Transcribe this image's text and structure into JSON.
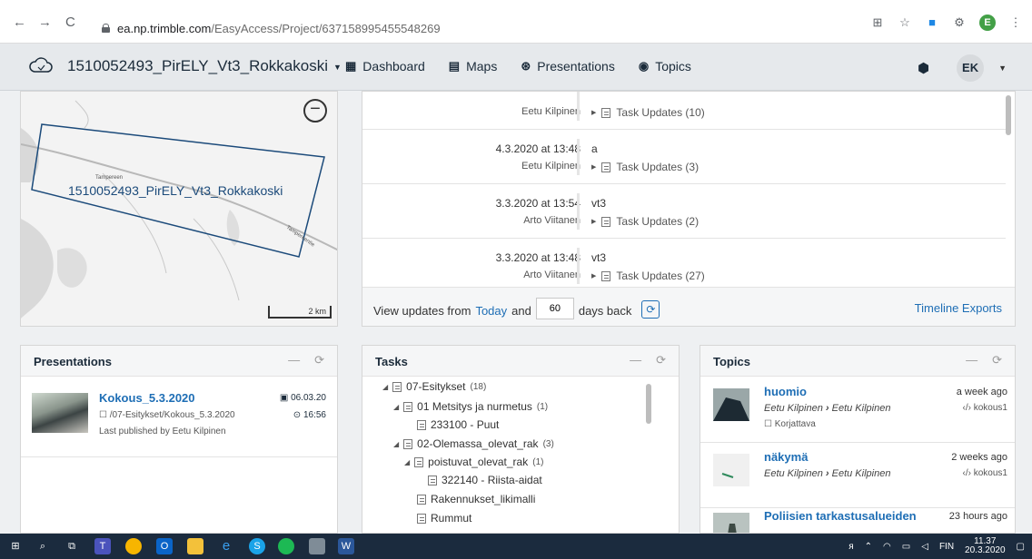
{
  "browser": {
    "back": "←",
    "forward": "→",
    "reload": "C",
    "url_host": "ea.np.trimble.com",
    "url_path": "/EasyAccess/Project/637158995455548269",
    "profile_initial": "E"
  },
  "header": {
    "project_title": "1510052493_PirELY_Vt3_Rokkakoski",
    "nav": [
      {
        "label": "Dashboard",
        "icon": "▦"
      },
      {
        "label": "Maps",
        "icon": "▤"
      },
      {
        "label": "Presentations",
        "icon": "⊛"
      },
      {
        "label": "Topics",
        "icon": "◉"
      }
    ],
    "user_initials": "EK"
  },
  "map": {
    "label": "1510052493_PirELY_Vt3_Rokkakoski",
    "zoom_out": "−",
    "scale": "2 km",
    "road_label_1": "Tampereen",
    "road_label_2": "Tampereentie"
  },
  "updates": {
    "rows": [
      {
        "date": "",
        "author": "Eetu Kilpinen",
        "title": "",
        "tasks": "Task Updates (10)"
      },
      {
        "date": "4.3.2020 at 13:48",
        "author": "Eetu Kilpinen",
        "title": "a",
        "tasks": "Task Updates (3)"
      },
      {
        "date": "3.3.2020 at 13:54",
        "author": "Arto Viitanen",
        "title": "vt3",
        "tasks": "Task Updates (2)"
      },
      {
        "date": "3.3.2020 at 13:48",
        "author": "Arto Viitanen",
        "title": "vt3",
        "tasks": "Task Updates (27)"
      }
    ],
    "footer_prefix": "View updates from",
    "footer_today": "Today",
    "footer_and": "and",
    "days_value": "60",
    "footer_suffix": "days back",
    "timeline_exports": "Timeline Exports"
  },
  "presentations": {
    "title": "Presentations",
    "item": {
      "name": "Kokous_5.3.2020",
      "path": "/07-Esitykset/Kokous_5.3.2020",
      "published": "Last published by Eetu Kilpinen",
      "date": "06.03.20",
      "time": "16:56"
    }
  },
  "tasks": {
    "title": "Tasks",
    "tree": [
      {
        "label": "07-Esitykset",
        "count": "(18)"
      },
      {
        "label": "01 Metsitys ja nurmetus",
        "count": "(1)"
      },
      {
        "label": "233100 - Puut",
        "count": ""
      },
      {
        "label": "02-Olemassa_olevat_rak",
        "count": "(3)"
      },
      {
        "label": "poistuvat_olevat_rak",
        "count": "(1)"
      },
      {
        "label": "322140 - Riista-aidat",
        "count": ""
      },
      {
        "label": "Rakennukset_likimalli",
        "count": ""
      },
      {
        "label": "Rummut",
        "count": ""
      }
    ]
  },
  "topics": {
    "title": "Topics",
    "items": [
      {
        "title": "huomio",
        "from": "Eetu Kilpinen",
        "to": "Eetu Kilpinen",
        "tag": "Korjattava",
        "time": "a week ago",
        "code": "kokous1"
      },
      {
        "title": "näkymä",
        "from": "Eetu Kilpinen",
        "to": "Eetu Kilpinen",
        "tag": "",
        "time": "2 weeks ago",
        "code": "kokous1"
      },
      {
        "title": "Poliisien tarkastusalueiden",
        "from": "",
        "to": "",
        "tag": "",
        "time": "23 hours ago",
        "code": ""
      }
    ]
  },
  "taskbar": {
    "lang": "FIN",
    "time": "11.37",
    "date": "20.3.2020"
  }
}
